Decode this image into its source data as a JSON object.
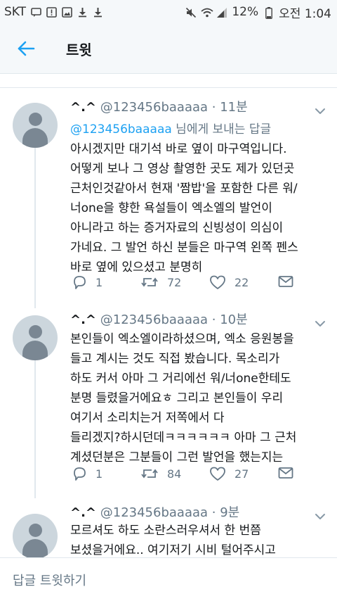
{
  "status_bar": {
    "carrier": "SKT",
    "battery": "12%",
    "time": "오전 1:04",
    "left_icons": [
      "chat-icon",
      "alert-icon",
      "image-icon",
      "download-icon",
      "download-icon"
    ],
    "right_icons": [
      "mute-icon",
      "wifi-icon",
      "signal-icon",
      "battery-icon"
    ]
  },
  "app_bar": {
    "title": "트윗",
    "back_icon": "arrow-left-icon",
    "accent_color": "#1da1f2"
  },
  "tweets": [
    {
      "name": "^.^",
      "handle": "@123456baaaaa",
      "time": "· 11분",
      "reply_mention": "@123456baaaaa",
      "reply_suffix": " 님에게 보내는 답글",
      "lines": [
        "아시겠지만 대기석 바로 옆이 마구역입니다.",
        "어떻게 보나 그 영상 촬영한 곳도 제가 있던곳",
        "근처인것같아서 현재 '짬밥'을 포함한 다른 워/",
        "너one을 향한 욕설들이 엑소엘의 발언이",
        "아니라고 하는 증거자료의 신빙성이 의심이",
        "가네요. 그 발언 하신 분들은 마구역 왼쪽 펜스",
        "바로 옆에 있으셨고 분명히"
      ],
      "replies": "1",
      "retweets": "72",
      "likes": "22"
    },
    {
      "name": "^.^",
      "handle": "@123456baaaaa",
      "time": "· 10분",
      "lines": [
        "본인들이 엑소엘이라하셨으며, 엑소 응원봉을",
        "들고 계시는 것도 직접 봤습니다. 목소리가",
        "하도 커서 아마 그 거리에선 워/너one한테도",
        "분명 들렸을거에요ㅎ 그리고 본인들이 우리",
        "여기서 소리치는거 저쪽에서 다",
        "들리겠지?하시던데ㅋㅋㅋㅋㅋㅋ 아마 그 근처",
        "계셨던분은 그분들이 그런 발언을 했는지는"
      ],
      "replies": "1",
      "retweets": "84",
      "likes": "27"
    },
    {
      "name": "^.^",
      "handle": "@123456baaaaa",
      "time": "· 9분",
      "lines": [
        "모르셔도 하도 소란스러우셔서 한 번쯤",
        "보셨을거에요.. 여기저기 시비 털어주시고"
      ]
    }
  ],
  "composer": {
    "placeholder": "답글 트윗하기"
  }
}
